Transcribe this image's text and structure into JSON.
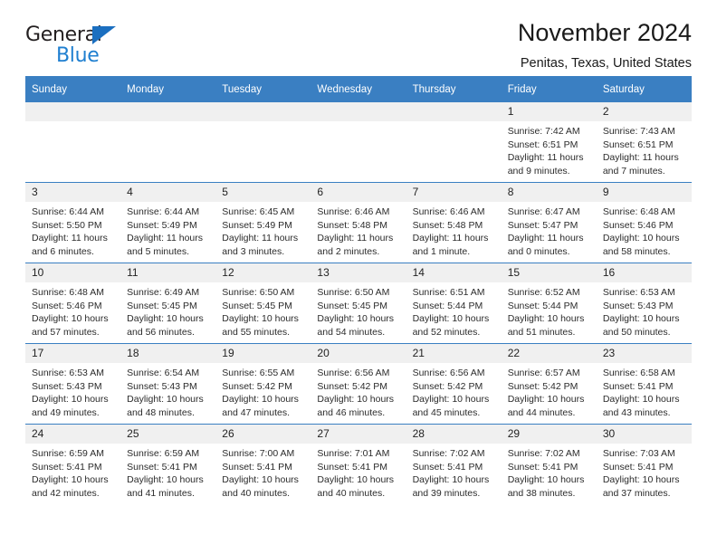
{
  "brand": {
    "name_part1": "General",
    "name_part2": "Blue",
    "accent_color": "#1f7fd0",
    "triangle_icon": "brand-triangle-icon"
  },
  "header": {
    "title": "November 2024",
    "subtitle": "Penitas, Texas, United States"
  },
  "theme": {
    "header_bg": "#3a7fc2",
    "daynum_bg": "#f0f0f0",
    "grid_line": "#3a7fc2"
  },
  "weekday_headers": [
    "Sunday",
    "Monday",
    "Tuesday",
    "Wednesday",
    "Thursday",
    "Friday",
    "Saturday"
  ],
  "weeks": [
    [
      {
        "day": "",
        "lines": []
      },
      {
        "day": "",
        "lines": []
      },
      {
        "day": "",
        "lines": []
      },
      {
        "day": "",
        "lines": []
      },
      {
        "day": "",
        "lines": []
      },
      {
        "day": "1",
        "lines": [
          "Sunrise: 7:42 AM",
          "Sunset: 6:51 PM",
          "Daylight: 11 hours",
          "and 9 minutes."
        ]
      },
      {
        "day": "2",
        "lines": [
          "Sunrise: 7:43 AM",
          "Sunset: 6:51 PM",
          "Daylight: 11 hours",
          "and 7 minutes."
        ]
      }
    ],
    [
      {
        "day": "3",
        "lines": [
          "Sunrise: 6:44 AM",
          "Sunset: 5:50 PM",
          "Daylight: 11 hours",
          "and 6 minutes."
        ]
      },
      {
        "day": "4",
        "lines": [
          "Sunrise: 6:44 AM",
          "Sunset: 5:49 PM",
          "Daylight: 11 hours",
          "and 5 minutes."
        ]
      },
      {
        "day": "5",
        "lines": [
          "Sunrise: 6:45 AM",
          "Sunset: 5:49 PM",
          "Daylight: 11 hours",
          "and 3 minutes."
        ]
      },
      {
        "day": "6",
        "lines": [
          "Sunrise: 6:46 AM",
          "Sunset: 5:48 PM",
          "Daylight: 11 hours",
          "and 2 minutes."
        ]
      },
      {
        "day": "7",
        "lines": [
          "Sunrise: 6:46 AM",
          "Sunset: 5:48 PM",
          "Daylight: 11 hours",
          "and 1 minute."
        ]
      },
      {
        "day": "8",
        "lines": [
          "Sunrise: 6:47 AM",
          "Sunset: 5:47 PM",
          "Daylight: 11 hours",
          "and 0 minutes."
        ]
      },
      {
        "day": "9",
        "lines": [
          "Sunrise: 6:48 AM",
          "Sunset: 5:46 PM",
          "Daylight: 10 hours",
          "and 58 minutes."
        ]
      }
    ],
    [
      {
        "day": "10",
        "lines": [
          "Sunrise: 6:48 AM",
          "Sunset: 5:46 PM",
          "Daylight: 10 hours",
          "and 57 minutes."
        ]
      },
      {
        "day": "11",
        "lines": [
          "Sunrise: 6:49 AM",
          "Sunset: 5:45 PM",
          "Daylight: 10 hours",
          "and 56 minutes."
        ]
      },
      {
        "day": "12",
        "lines": [
          "Sunrise: 6:50 AM",
          "Sunset: 5:45 PM",
          "Daylight: 10 hours",
          "and 55 minutes."
        ]
      },
      {
        "day": "13",
        "lines": [
          "Sunrise: 6:50 AM",
          "Sunset: 5:45 PM",
          "Daylight: 10 hours",
          "and 54 minutes."
        ]
      },
      {
        "day": "14",
        "lines": [
          "Sunrise: 6:51 AM",
          "Sunset: 5:44 PM",
          "Daylight: 10 hours",
          "and 52 minutes."
        ]
      },
      {
        "day": "15",
        "lines": [
          "Sunrise: 6:52 AM",
          "Sunset: 5:44 PM",
          "Daylight: 10 hours",
          "and 51 minutes."
        ]
      },
      {
        "day": "16",
        "lines": [
          "Sunrise: 6:53 AM",
          "Sunset: 5:43 PM",
          "Daylight: 10 hours",
          "and 50 minutes."
        ]
      }
    ],
    [
      {
        "day": "17",
        "lines": [
          "Sunrise: 6:53 AM",
          "Sunset: 5:43 PM",
          "Daylight: 10 hours",
          "and 49 minutes."
        ]
      },
      {
        "day": "18",
        "lines": [
          "Sunrise: 6:54 AM",
          "Sunset: 5:43 PM",
          "Daylight: 10 hours",
          "and 48 minutes."
        ]
      },
      {
        "day": "19",
        "lines": [
          "Sunrise: 6:55 AM",
          "Sunset: 5:42 PM",
          "Daylight: 10 hours",
          "and 47 minutes."
        ]
      },
      {
        "day": "20",
        "lines": [
          "Sunrise: 6:56 AM",
          "Sunset: 5:42 PM",
          "Daylight: 10 hours",
          "and 46 minutes."
        ]
      },
      {
        "day": "21",
        "lines": [
          "Sunrise: 6:56 AM",
          "Sunset: 5:42 PM",
          "Daylight: 10 hours",
          "and 45 minutes."
        ]
      },
      {
        "day": "22",
        "lines": [
          "Sunrise: 6:57 AM",
          "Sunset: 5:42 PM",
          "Daylight: 10 hours",
          "and 44 minutes."
        ]
      },
      {
        "day": "23",
        "lines": [
          "Sunrise: 6:58 AM",
          "Sunset: 5:41 PM",
          "Daylight: 10 hours",
          "and 43 minutes."
        ]
      }
    ],
    [
      {
        "day": "24",
        "lines": [
          "Sunrise: 6:59 AM",
          "Sunset: 5:41 PM",
          "Daylight: 10 hours",
          "and 42 minutes."
        ]
      },
      {
        "day": "25",
        "lines": [
          "Sunrise: 6:59 AM",
          "Sunset: 5:41 PM",
          "Daylight: 10 hours",
          "and 41 minutes."
        ]
      },
      {
        "day": "26",
        "lines": [
          "Sunrise: 7:00 AM",
          "Sunset: 5:41 PM",
          "Daylight: 10 hours",
          "and 40 minutes."
        ]
      },
      {
        "day": "27",
        "lines": [
          "Sunrise: 7:01 AM",
          "Sunset: 5:41 PM",
          "Daylight: 10 hours",
          "and 40 minutes."
        ]
      },
      {
        "day": "28",
        "lines": [
          "Sunrise: 7:02 AM",
          "Sunset: 5:41 PM",
          "Daylight: 10 hours",
          "and 39 minutes."
        ]
      },
      {
        "day": "29",
        "lines": [
          "Sunrise: 7:02 AM",
          "Sunset: 5:41 PM",
          "Daylight: 10 hours",
          "and 38 minutes."
        ]
      },
      {
        "day": "30",
        "lines": [
          "Sunrise: 7:03 AM",
          "Sunset: 5:41 PM",
          "Daylight: 10 hours",
          "and 37 minutes."
        ]
      }
    ]
  ]
}
